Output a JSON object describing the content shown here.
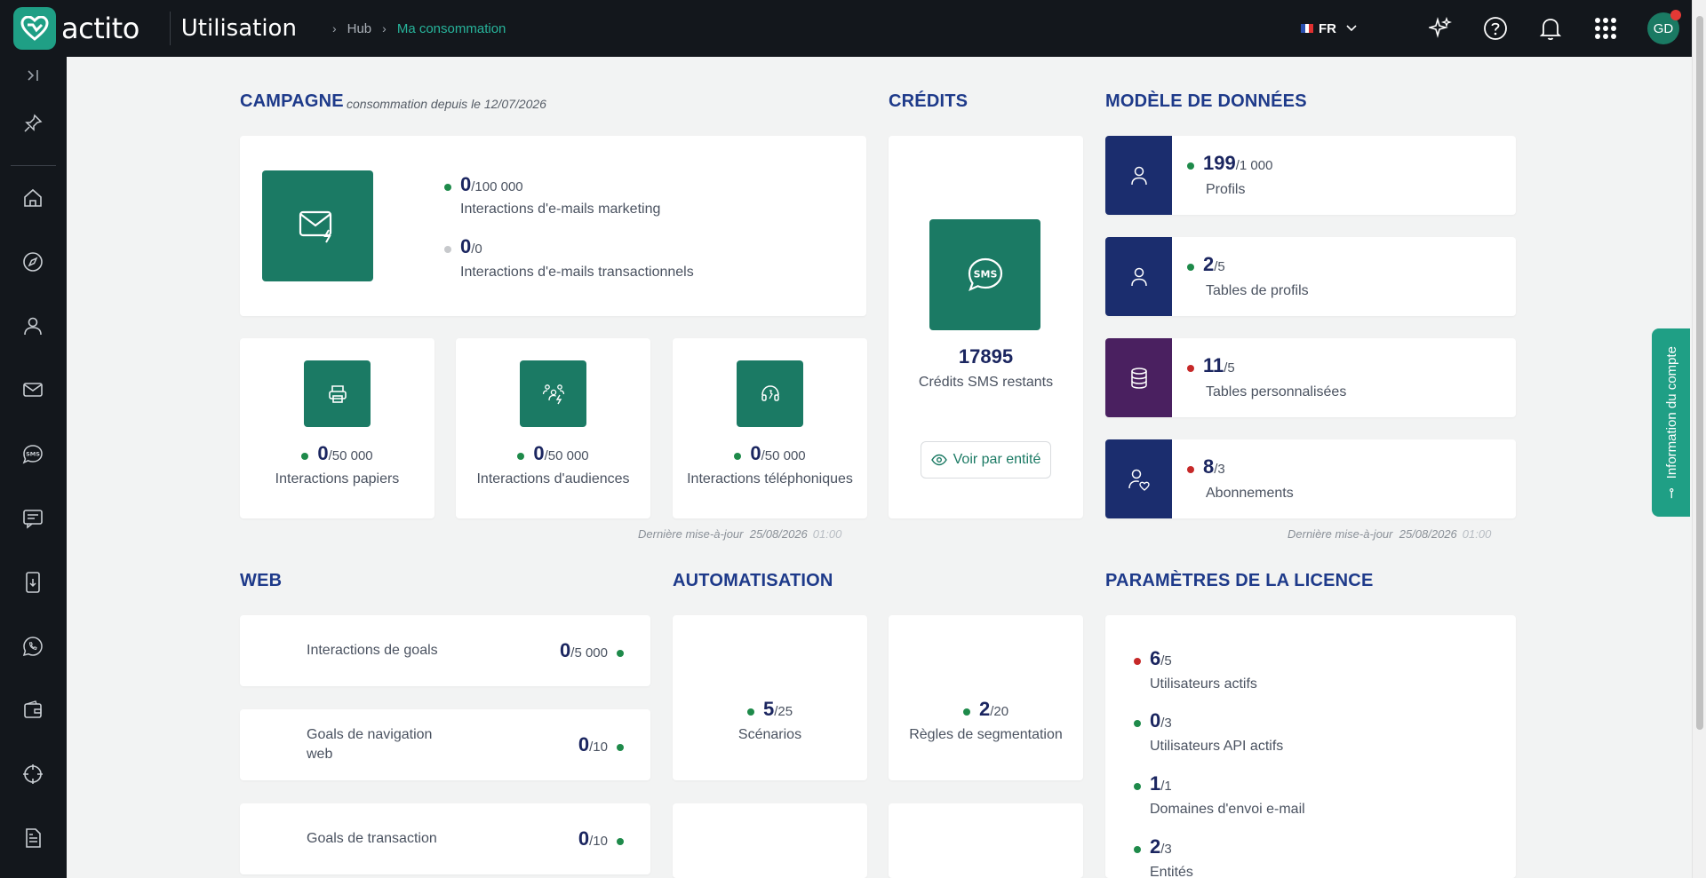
{
  "app": {
    "logo_text": "actito",
    "page_title": "Utilisation",
    "breadcrumb": [
      "Hub",
      "Ma consommation"
    ],
    "language": "FR",
    "avatar_initials": "GD",
    "account_tab": "Information du compte"
  },
  "campagne": {
    "title": "CAMPAGNE",
    "subtitle": "consommation depuis le 12/07/2026",
    "email_marketing": {
      "value": "0",
      "max": "/100 000",
      "label": "Interactions d'e-mails marketing"
    },
    "email_transactional": {
      "value": "0",
      "max": "/0",
      "label": "Interactions d'e-mails transactionnels"
    },
    "papiers": {
      "value": "0",
      "max": "/50 000",
      "label": "Interactions papiers"
    },
    "audiences": {
      "value": "0",
      "max": "/50 000",
      "label": "Interactions d'audiences"
    },
    "telephoniques": {
      "value": "0",
      "max": "/50 000",
      "label": "Interactions téléphoniques"
    },
    "last_update_label": "Dernière mise-à-jour",
    "last_update_date": "25/08/2026",
    "last_update_time": "01:00"
  },
  "credits": {
    "title": "CRÉDITS",
    "sms_value": "17895",
    "sms_label": "Crédits SMS restants",
    "button_label": "Voir par entité"
  },
  "modele": {
    "title": "MODÈLE DE DONNÉES",
    "items": [
      {
        "value": "199",
        "max": "/1 000",
        "label": "Profils",
        "status": "green"
      },
      {
        "value": "2",
        "max": "/5",
        "label": "Tables de profils",
        "status": "green"
      },
      {
        "value": "11",
        "max": "/5",
        "label": "Tables personnalisées",
        "status": "red"
      },
      {
        "value": "8",
        "max": "/3",
        "label": "Abonnements",
        "status": "red"
      }
    ],
    "last_update_label": "Dernière mise-à-jour",
    "last_update_date": "25/08/2026",
    "last_update_time": "01:00"
  },
  "web": {
    "title": "WEB",
    "items": [
      {
        "label": "Interactions de goals",
        "value": "0",
        "max": "/5 000"
      },
      {
        "label": "Goals de navigation web",
        "value": "0",
        "max": "/10"
      },
      {
        "label": "Goals de transaction",
        "value": "0",
        "max": "/10"
      }
    ]
  },
  "automatisation": {
    "title": "AUTOMATISATION",
    "scenarios": {
      "value": "5",
      "max": "/25",
      "label": "Scénarios"
    },
    "segmentation": {
      "value": "2",
      "max": "/20",
      "label": "Règles de segmentation"
    }
  },
  "licence": {
    "title": "PARAMÈTRES DE LA LICENCE",
    "items": [
      {
        "value": "6",
        "max": "/5",
        "label": "Utilisateurs actifs",
        "status": "red"
      },
      {
        "value": "0",
        "max": "/3",
        "label": "Utilisateurs API actifs",
        "status": "green"
      },
      {
        "value": "1",
        "max": "/1",
        "label": "Domaines d'envoi e-mail",
        "status": "green"
      },
      {
        "value": "2",
        "max": "/3",
        "label": "Entités",
        "status": "green"
      }
    ]
  },
  "colors": {
    "accent": "#1b7a64",
    "navy": "#1b2d6e",
    "purple": "#4a2060",
    "status_green": "#1e8a4a",
    "status_red": "#c62828"
  }
}
